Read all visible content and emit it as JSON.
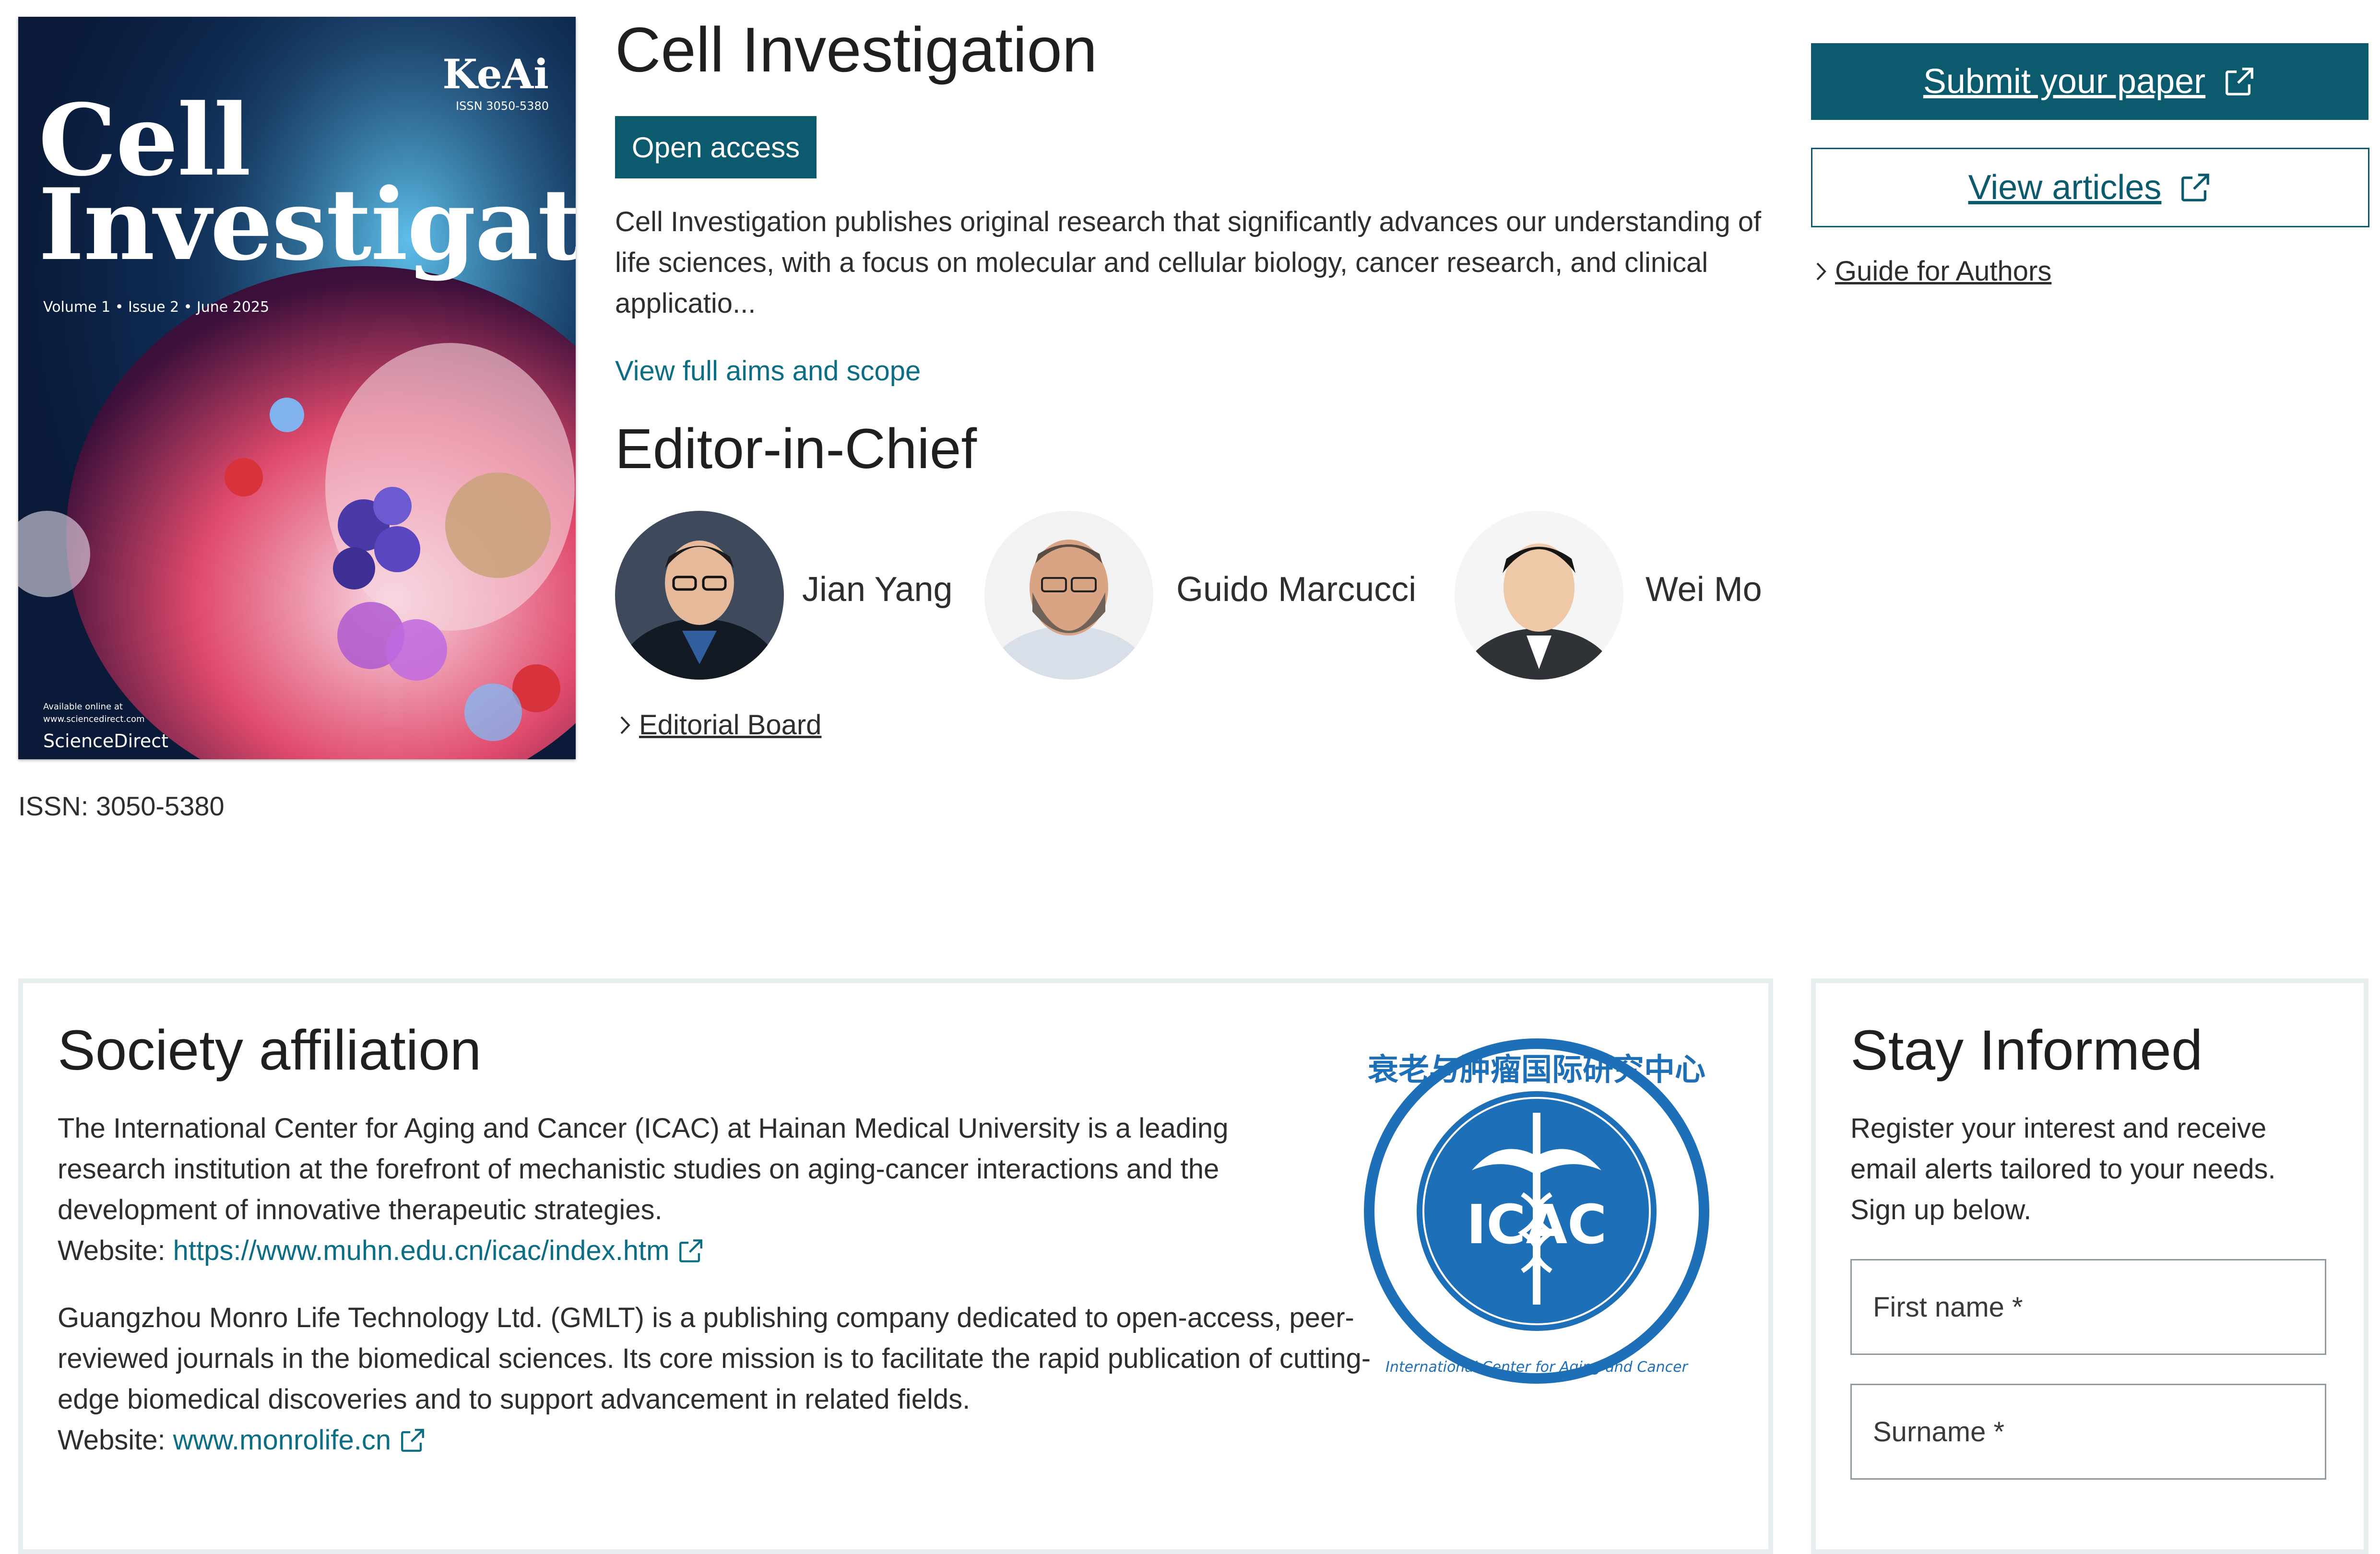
{
  "cover": {
    "brand": "KeAi",
    "issn_small": "ISSN 3050-5380",
    "title_line1": "Cell",
    "title_line2": "Investigation",
    "volume": "Volume 1 • Issue 2 • June 2025",
    "available_line1": "Available online at",
    "available_line2": "www.sciencedirect.com",
    "publisher": "ScienceDirect"
  },
  "issn": "ISSN: 3050-5380",
  "journal": {
    "title": "Cell Investigation",
    "badge": "Open access",
    "description": "Cell Investigation publishes original research that significantly advances our understanding of life sciences, with a focus on molecular and cellular biology, cancer research, and clinical applicatio...",
    "aims_link": "View full aims and scope"
  },
  "editors": {
    "heading": "Editor-in-Chief",
    "people": [
      {
        "name": "Jian Yang"
      },
      {
        "name": "Guido Marcucci"
      },
      {
        "name": "Wei Mo"
      }
    ],
    "board_link": "Editorial Board"
  },
  "actions": {
    "submit": "Submit your paper",
    "view": "View articles",
    "guide": "Guide for Authors"
  },
  "society": {
    "heading": "Society affiliation",
    "para1": "The International Center for Aging and Cancer (ICAC) at Hainan Medical University is a leading research institution at the forefront of mechanistic studies on aging-cancer interactions and the development of innovative therapeutic strategies.",
    "website_label": "Website:",
    "website1": "https://www.muhn.edu.cn/icac/index.htm",
    "para2": "Guangzhou Monro Life Technology Ltd. (GMLT) is a publishing company dedicated to open-access, peer-reviewed journals in the biomedical sciences. Its core mission is to facilitate the rapid publication of cutting-edge biomedical discoveries and to support advancement in related fields.",
    "website2": "www.monrolife.cn",
    "logo": {
      "text": "ICAC",
      "chinese": "衰老与肿瘤国际研究中心",
      "english": "International Center for Aging and Cancer"
    }
  },
  "newsletter": {
    "heading": "Stay Informed",
    "text": "Register your interest and receive email alerts tailored to your needs. Sign up below.",
    "first_name": "First name *",
    "surname": "Surname *"
  },
  "colors": {
    "primary": "#0c5a6e",
    "link": "#0c6e85",
    "panel_border": "#e8eef0"
  }
}
